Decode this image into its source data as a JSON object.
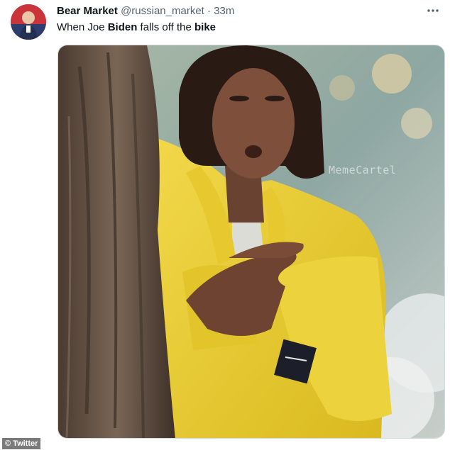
{
  "tweet": {
    "author_name": "Bear Market",
    "handle": "@russian_market",
    "separator": "·",
    "time": "33m",
    "more_icon": "more-horizontal-icon",
    "text_parts": [
      "When Joe ",
      "Biden",
      " falls off the ",
      "bike"
    ]
  },
  "media": {
    "watermark": "MemeCartel"
  },
  "credit": "© Twitter",
  "colors": {
    "name": "#0f1419",
    "secondary": "#536471",
    "jacket": "#e9cc2e",
    "avatar_bg": "#c9353b"
  }
}
